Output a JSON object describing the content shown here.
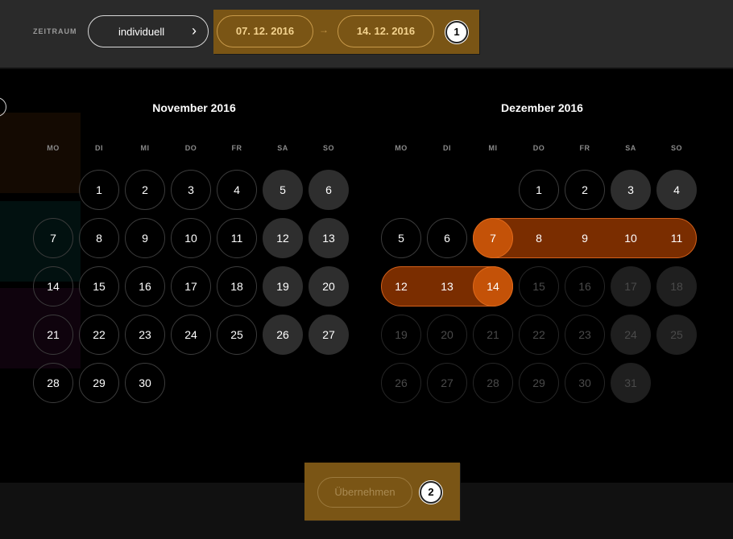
{
  "toolbar": {
    "zeitraum_label": "ZEITRAUM",
    "period_selector": "individuell",
    "date_from": "07. 12. 2016",
    "date_to": "14. 12. 2016",
    "marker_1": "1"
  },
  "weekdays": [
    "MO",
    "DI",
    "MI",
    "DO",
    "FR",
    "SA",
    "SO"
  ],
  "calendar": {
    "november": {
      "title": "November 2016",
      "days": [
        "1",
        "2",
        "3",
        "4",
        "5",
        "6",
        "7",
        "8",
        "9",
        "10",
        "11",
        "12",
        "13",
        "14",
        "15",
        "16",
        "17",
        "18",
        "19",
        "20",
        "21",
        "22",
        "23",
        "24",
        "25",
        "26",
        "27",
        "28",
        "29",
        "30"
      ]
    },
    "december": {
      "title": "Dezember 2016",
      "days": [
        "1",
        "2",
        "3",
        "4",
        "5",
        "6",
        "7",
        "8",
        "9",
        "10",
        "11",
        "12",
        "13",
        "14",
        "15",
        "16",
        "17",
        "18",
        "19",
        "20",
        "21",
        "22",
        "23",
        "24",
        "25",
        "26",
        "27",
        "28",
        "29",
        "30",
        "31"
      ]
    }
  },
  "footer": {
    "apply_label": "Übernehmen",
    "marker_2": "2"
  },
  "colors": {
    "accent": "#c45208",
    "range": "#7a2d00",
    "highlight": "#7a5515"
  }
}
